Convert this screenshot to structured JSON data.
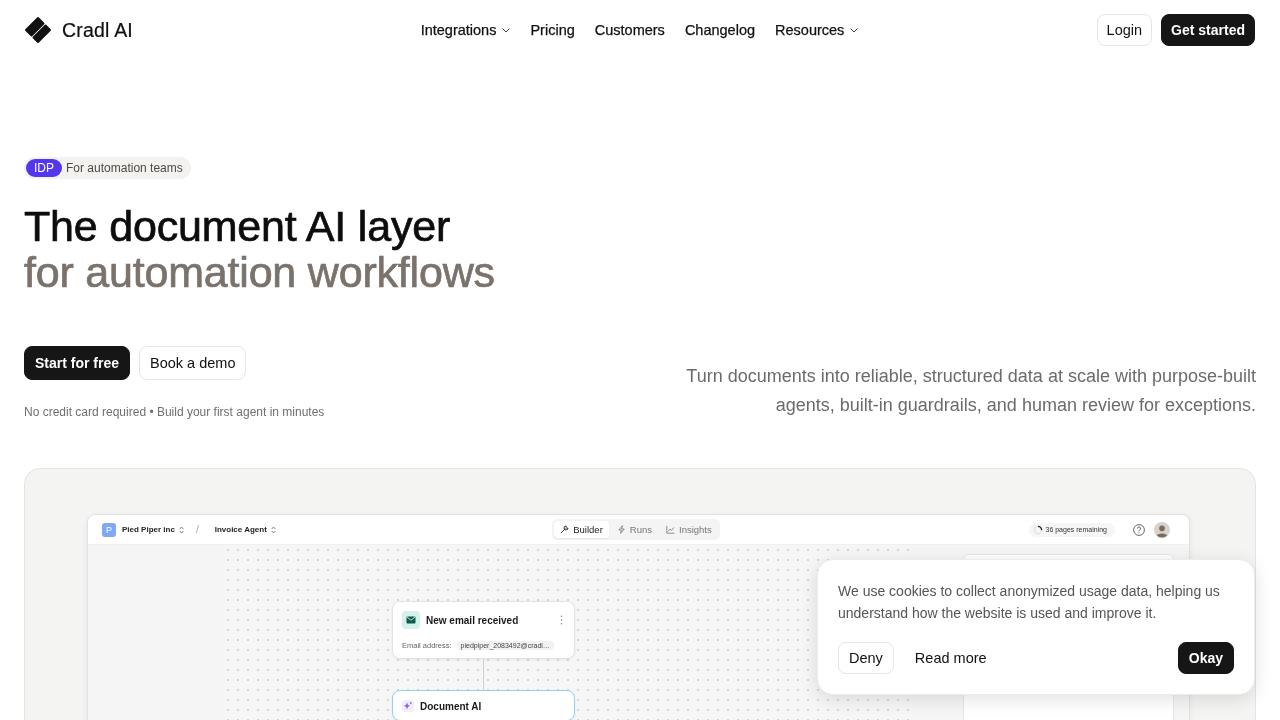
{
  "header": {
    "brand": "Cradl AI",
    "nav": [
      {
        "label": "Integrations",
        "dropdown": true
      },
      {
        "label": "Pricing",
        "dropdown": false
      },
      {
        "label": "Customers",
        "dropdown": false
      },
      {
        "label": "Changelog",
        "dropdown": false
      },
      {
        "label": "Resources",
        "dropdown": true
      }
    ],
    "actions": [
      {
        "label": "Login",
        "kind": "secondary"
      },
      {
        "label": "Get started",
        "kind": "primary"
      }
    ]
  },
  "hero": {
    "badge": {
      "tag": "IDP",
      "text": "For automation teams"
    },
    "title": "The document AI layer",
    "title_accent": "for automation workflows",
    "buttons": [
      {
        "label": "Start for free",
        "kind": "primary"
      },
      {
        "label": "Book a demo",
        "kind": "secondary"
      }
    ],
    "note": "No credit card required • Build your first agent in minutes",
    "description": "Turn documents into reliable, structured data at scale with purpose-built agents, built-in guardrails, and human review for exceptions."
  },
  "app_preview": {
    "workspace": {
      "initial": "P",
      "name": "Pied Piper inc"
    },
    "separator": "/",
    "agent": "Invoice Agent",
    "tabs": [
      {
        "label": "Builder",
        "selected": true
      },
      {
        "label": "Runs",
        "selected": false
      },
      {
        "label": "Insights",
        "selected": false
      }
    ],
    "usage": {
      "text": "36 pages remaining",
      "level": 0.25
    },
    "nodes": [
      {
        "kind": "trigger",
        "title": "New email received",
        "field_label": "Email address:",
        "field_value": "piedpiper_2083492@cradl…",
        "selected": false
      },
      {
        "kind": "ai",
        "title": "Document AI",
        "selected": true
      }
    ]
  },
  "cookie_banner": {
    "message": "We use cookies to collect anonymized usage data, helping us understand how the website is used and improve it.",
    "buttons": [
      {
        "label": "Deny",
        "kind": "outline"
      },
      {
        "label": "Read more",
        "kind": "text"
      },
      {
        "label": "Okay",
        "kind": "primary"
      }
    ]
  }
}
